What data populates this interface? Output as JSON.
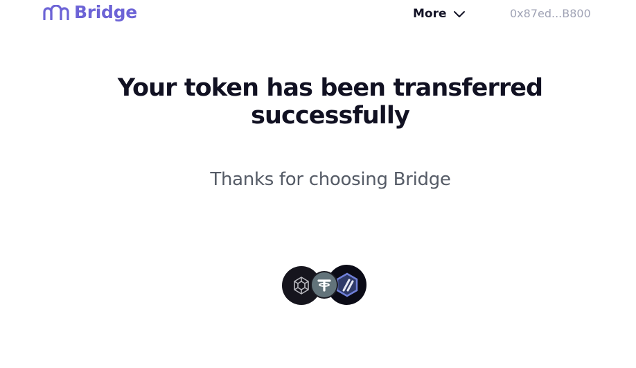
{
  "header": {
    "logo_text": "Bridge",
    "more_label": "More",
    "wallet_address": "0x87ed...B800"
  },
  "main": {
    "title_line1": "Your token has been transferred",
    "title_line2": "successfully",
    "subtitle": "Thanks for choosing Bridge"
  },
  "tokens": [
    {
      "icon": "bnb-chain-icon"
    },
    {
      "icon": "usdt-icon"
    },
    {
      "icon": "arbitrum-icon"
    }
  ],
  "colors": {
    "brand": "#6c63d6",
    "title": "#111122",
    "subtitle": "#555b66",
    "wallet": "#a0a3b5"
  }
}
